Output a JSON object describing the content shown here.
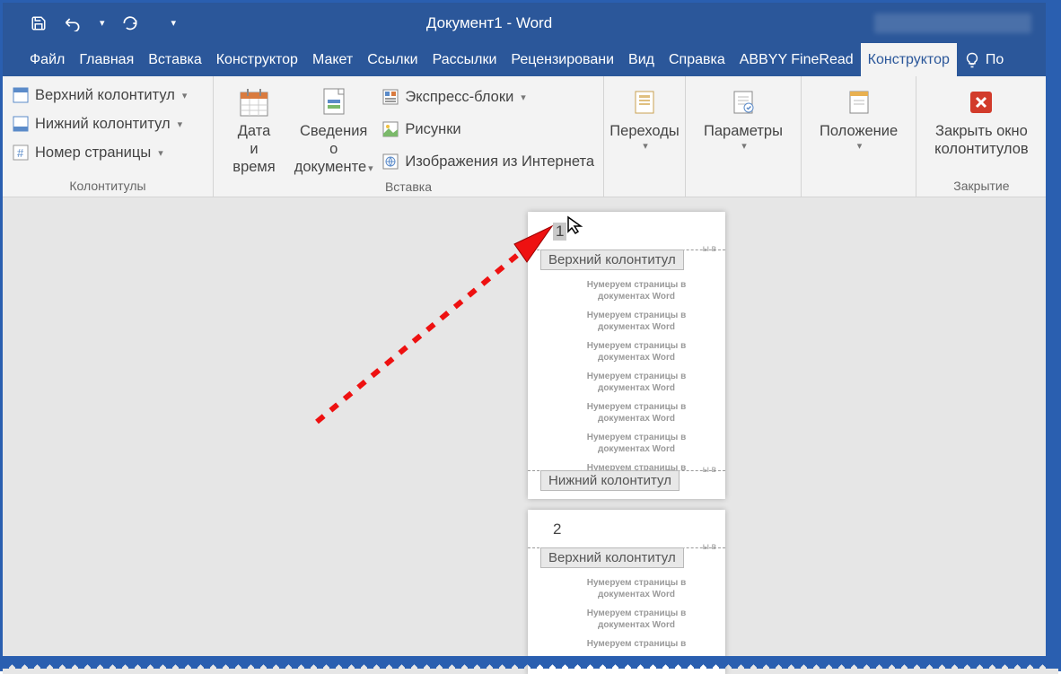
{
  "title": "Документ1  -  Word",
  "tabs": {
    "file": "Файл",
    "home": "Главная",
    "insert": "Вставка",
    "design": "Конструктор",
    "layout": "Макет",
    "refs": "Ссылки",
    "mailings": "Рассылки",
    "review": "Рецензировани",
    "view": "Вид",
    "help": "Справка",
    "abbyy": "ABBYY FineRead",
    "hf_design": "Конструктор",
    "tell": "По"
  },
  "ribbon": {
    "group_hf": {
      "header": "Верхний колонтитул",
      "footer": "Нижний колонтитул",
      "pagenum": "Номер страницы",
      "label": "Колонтитулы"
    },
    "group_insert": {
      "datetime_l1": "Дата и",
      "datetime_l2": "время",
      "docinfo_l1": "Сведения о",
      "docinfo_l2": "документе",
      "quickparts": "Экспресс-блоки",
      "pictures": "Рисунки",
      "webpics": "Изображения из Интернета",
      "label": "Вставка"
    },
    "group_nav": {
      "goto": "Переходы",
      "options": "Параметры",
      "position": "Положение"
    },
    "group_close": {
      "close_l1": "Закрыть окно",
      "close_l2": "колонтитулов",
      "label": "Закрытие"
    }
  },
  "doc": {
    "page1_number": "1",
    "page2_number": "2",
    "header_tag": "Верхний колонтитул",
    "footer_tag": "Нижний колонтитул",
    "body_line1": "Нумеруем страницы в",
    "body_line2": "документах Word",
    "edge_text": "ы в"
  }
}
